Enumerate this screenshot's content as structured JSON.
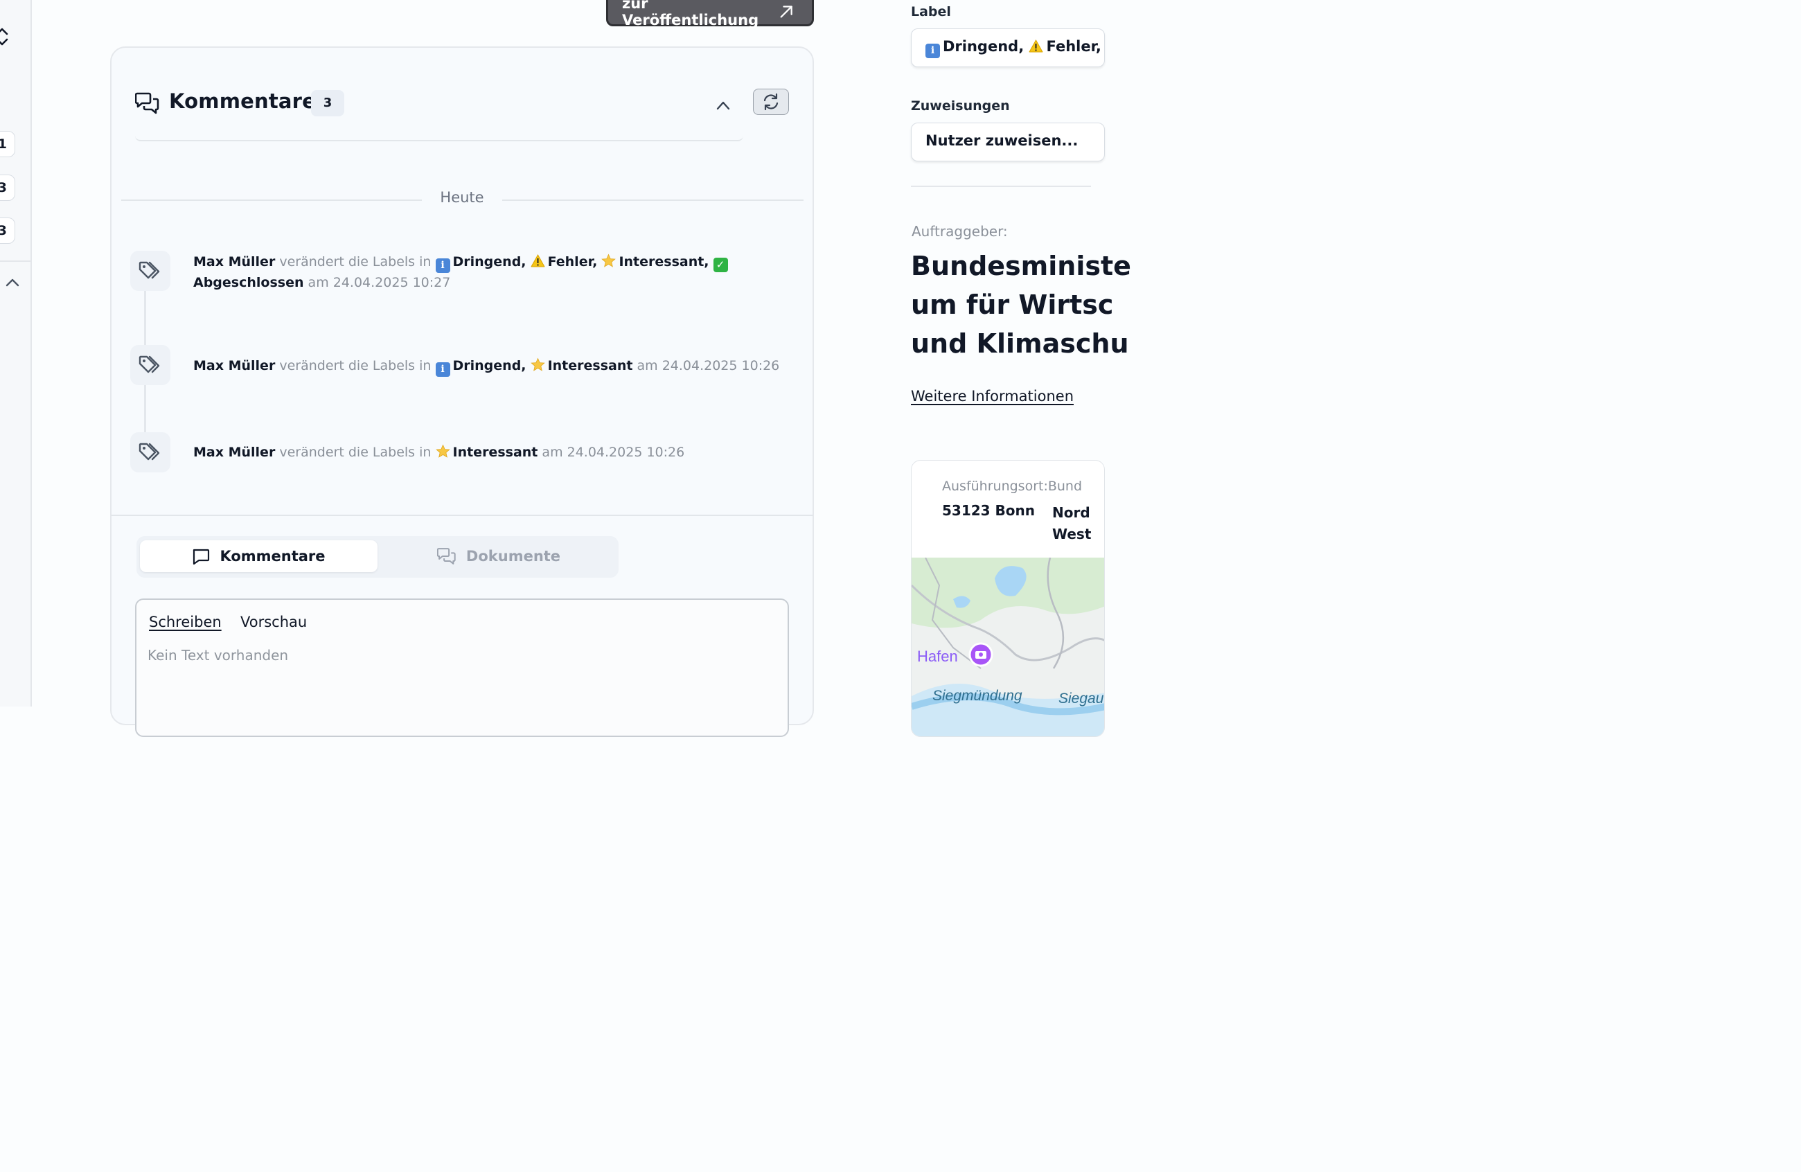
{
  "publish": {
    "label": "zur Veröffentlichung"
  },
  "sidebar": {
    "counts": [
      "1",
      "3",
      "3"
    ]
  },
  "comments": {
    "title": "Kommentare",
    "count": "3",
    "date_separator": "Heute",
    "events": [
      {
        "user": "Max Müller",
        "action": "verändert die Labels in",
        "labels": [
          {
            "emoji": "info",
            "text": "Dringend,"
          },
          {
            "emoji": "warning",
            "text": "Fehler,"
          },
          {
            "emoji": "star",
            "text": "Interessant,"
          },
          {
            "emoji": "check",
            "text": "Abgeschlossen"
          }
        ],
        "at_word": "am",
        "timestamp": "24.04.2025 10:27"
      },
      {
        "user": "Max Müller",
        "action": "verändert die Labels in",
        "labels": [
          {
            "emoji": "info",
            "text": "Dringend,"
          },
          {
            "emoji": "star",
            "text": "Interessant"
          }
        ],
        "at_word": "am",
        "timestamp": "24.04.2025 10:26"
      },
      {
        "user": "Max Müller",
        "action": "verändert die Labels in",
        "labels": [
          {
            "emoji": "star",
            "text": "Interessant"
          }
        ],
        "at_word": "am",
        "timestamp": "24.04.2025 10:26"
      }
    ],
    "tabs": [
      {
        "label": "Kommentare",
        "active": true
      },
      {
        "label": "Dokumente",
        "active": false
      }
    ],
    "editor": {
      "tabs": [
        "Schreiben",
        "Vorschau"
      ],
      "placeholder": "Kein Text vorhanden"
    }
  },
  "right_panel": {
    "label_field": {
      "label": "Label",
      "value_parts": [
        {
          "emoji": "info",
          "text": "Dringend,"
        },
        {
          "emoji": "warning",
          "text": "Fehler,"
        }
      ]
    },
    "assign_field": {
      "label": "Zuweisungen",
      "value": "Nutzer zuweisen..."
    },
    "client_label": "Auftraggeber:",
    "client_name_lines": [
      "Bundesministe",
      "um für Wirtsc",
      "und Klimaschu"
    ],
    "more_info_link": "Weitere Informationen",
    "location": {
      "label": "Ausführungsort:Bund",
      "city": "53123 Bonn",
      "state_lines": [
        "Nord",
        "West"
      ],
      "map_labels": {
        "hafen": "Hafen",
        "siegmuendung": "Siegmündung",
        "siegau": "Siegau"
      }
    }
  },
  "colors": {
    "accent_dark": "#5a5a60",
    "info_blue": "#4a86d8",
    "check_green": "#2fb344",
    "warning_yellow": "#f5c518",
    "star_yellow": "#f7c744",
    "map_pin_purple": "#a855f7",
    "map_label_purple": "#8b5cf6"
  }
}
